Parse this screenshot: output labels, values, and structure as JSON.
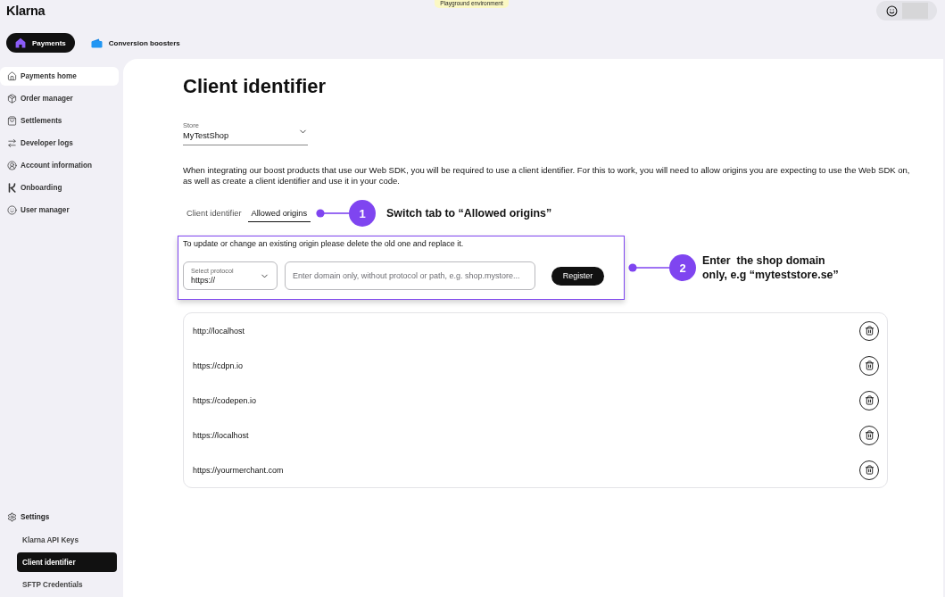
{
  "header": {
    "brand": "Klarna",
    "environment_badge": "Playground environment"
  },
  "product_tabs": [
    {
      "label": "Payments",
      "selected": true
    },
    {
      "label": "Conversion boosters",
      "selected": false
    }
  ],
  "sidebar": {
    "items": [
      {
        "label": "Payments home",
        "hovered": true
      },
      {
        "label": "Order manager",
        "hovered": false
      },
      {
        "label": "Settlements",
        "hovered": false
      },
      {
        "label": "Developer logs",
        "hovered": false
      },
      {
        "label": "Account information",
        "hovered": false
      },
      {
        "label": "Onboarding",
        "hovered": false
      },
      {
        "label": "User manager",
        "hovered": false
      }
    ],
    "settings": {
      "label": "Settings",
      "items": [
        {
          "label": "Klarna API Keys",
          "selected": false
        },
        {
          "label": "Client identifier",
          "selected": true
        },
        {
          "label": "SFTP Credentials",
          "selected": false
        }
      ]
    }
  },
  "page": {
    "title": "Client identifier",
    "store": {
      "label": "Store",
      "value": "MyTestShop"
    },
    "description": "When integrating our boost products that use our Web SDK, you will be required to use a client identifier. For this to work, you will need to allow origins you are expecting to use the Web SDK on, as well as create a client identifier and use it in your code.",
    "tabs": [
      {
        "label": "Client identifier",
        "selected": false
      },
      {
        "label": "Allowed origins",
        "selected": true
      }
    ],
    "origin_form": {
      "note": "To update or change an existing origin please delete the old one and replace it.",
      "protocol": {
        "label": "Select protocol",
        "value": "https://"
      },
      "domain": {
        "placeholder": "Enter domain only, without protocol or path, e.g. shop.mystore..."
      },
      "button": "Register"
    },
    "origins": [
      "http://localhost",
      "https://cdpn.io",
      "https://codepen.io",
      "https://localhost",
      "https://yourmerchant.com"
    ]
  },
  "annotations": [
    {
      "number": "1",
      "text": "Switch tab to “Allowed origins”"
    },
    {
      "number": "2",
      "text": "Enter  the shop domain only, e.g “myteststore.se”"
    }
  ]
}
